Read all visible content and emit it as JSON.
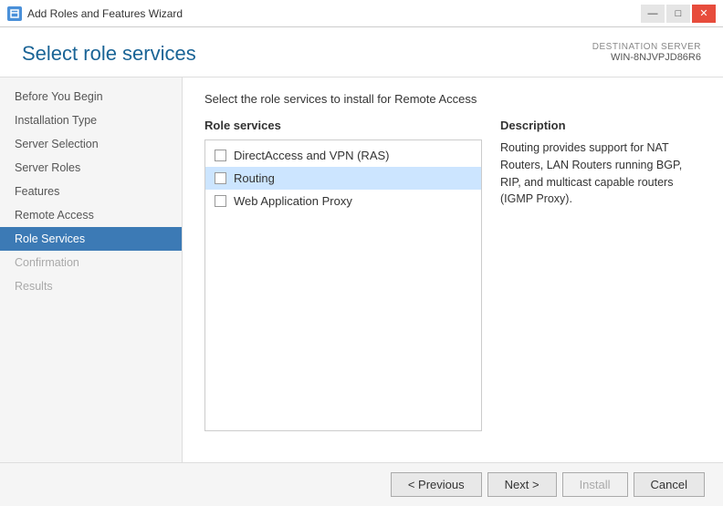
{
  "titlebar": {
    "title": "Add Roles and Features Wizard",
    "icon": "wizard-icon",
    "controls": {
      "minimize": "—",
      "maximize": "□",
      "close": "✕"
    }
  },
  "header": {
    "title": "Select role services",
    "destination_server_label": "DESTINATION SERVER",
    "destination_server_name": "WIN-8NJVPJD86R6"
  },
  "instruction": "Select the role services to install for Remote Access",
  "sidebar": {
    "items": [
      {
        "label": "Before You Begin",
        "state": "normal"
      },
      {
        "label": "Installation Type",
        "state": "normal"
      },
      {
        "label": "Server Selection",
        "state": "normal"
      },
      {
        "label": "Server Roles",
        "state": "normal"
      },
      {
        "label": "Features",
        "state": "normal"
      },
      {
        "label": "Remote Access",
        "state": "normal"
      },
      {
        "label": "Role Services",
        "state": "active"
      },
      {
        "label": "Confirmation",
        "state": "disabled"
      },
      {
        "label": "Results",
        "state": "disabled"
      }
    ]
  },
  "main": {
    "role_services_header": "Role services",
    "description_header": "Description",
    "description_text": "Routing provides support for NAT Routers, LAN Routers running BGP, RIP, and multicast capable routers (IGMP Proxy).",
    "services": [
      {
        "label": "DirectAccess and VPN (RAS)",
        "checked": false,
        "selected": false
      },
      {
        "label": "Routing",
        "checked": false,
        "selected": true
      },
      {
        "label": "Web Application Proxy",
        "checked": false,
        "selected": false
      }
    ]
  },
  "footer": {
    "previous_label": "< Previous",
    "next_label": "Next >",
    "install_label": "Install",
    "cancel_label": "Cancel"
  }
}
